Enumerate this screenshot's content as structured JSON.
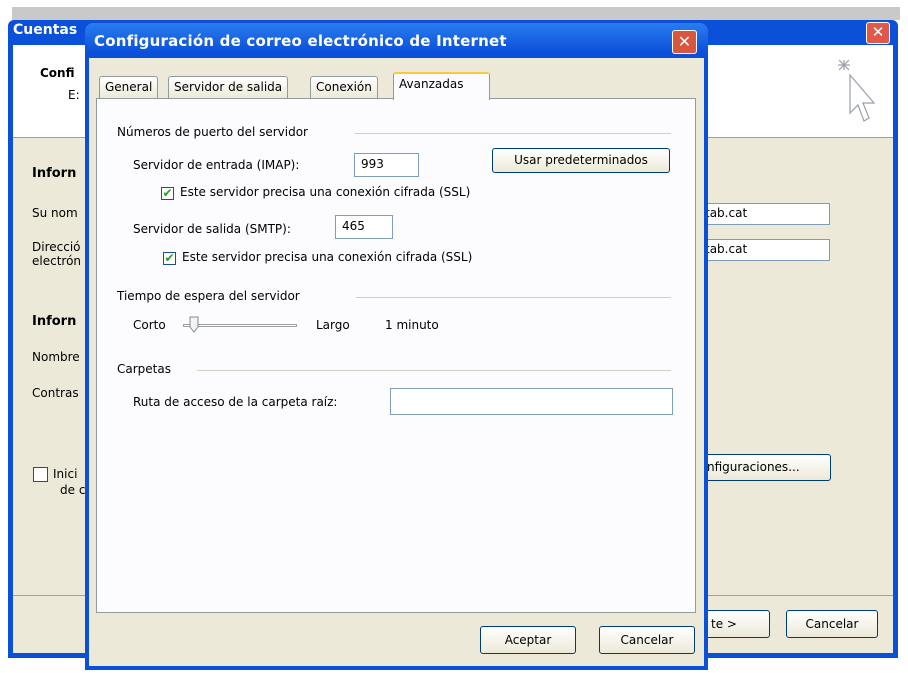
{
  "background_window": {
    "title": "Cuentas",
    "close_label": "✕",
    "header_line1": "Confi",
    "header_line2": "E:",
    "section1": "Inforn",
    "name_label": "Su nom",
    "email_label_1": "Direcció",
    "email_label_2": "electrón",
    "name_value": "tab.cat",
    "email_value": "tab.cat",
    "section2": "Inforn",
    "user_label": "Nombre",
    "password_label": "Contras",
    "checkbox_label_1": "Inici",
    "checkbox_label_2": "de c",
    "more_settings_label": "nfiguraciones...",
    "next_label": "te >",
    "cancel_label": "Cancelar"
  },
  "dialog": {
    "title": "Configuración de correo electrónico de Internet",
    "close_label": "✕",
    "tabs": [
      {
        "label": "General"
      },
      {
        "label": "Servidor de salida"
      },
      {
        "label": "Conexión"
      },
      {
        "label": "Avanzadas"
      }
    ],
    "ports": {
      "group_label": "Números de puerto del servidor",
      "incoming_label": "Servidor de entrada (IMAP):",
      "incoming_value": "993",
      "default_button": "Usar predeterminados",
      "ssl_incoming_label": "Este servidor precisa una conexión cifrada (SSL)",
      "ssl_incoming_checked": true,
      "outgoing_label": "Servidor de salida (SMTP):",
      "outgoing_value": "465",
      "ssl_outgoing_label": "Este servidor precisa una conexión cifrada (SSL)",
      "ssl_outgoing_checked": true
    },
    "timeout": {
      "group_label": "Tiempo de espera del servidor",
      "short_label": "Corto",
      "long_label": "Largo",
      "value_label": "1 minuto",
      "slider_level": 0.1
    },
    "folders": {
      "group_label": "Carpetas",
      "root_path_label": "Ruta de acceso de la carpeta raíz:",
      "root_path_value": ""
    },
    "ok_label": "Aceptar",
    "cancel_label": "Cancelar",
    "check_glyph": "✔"
  }
}
